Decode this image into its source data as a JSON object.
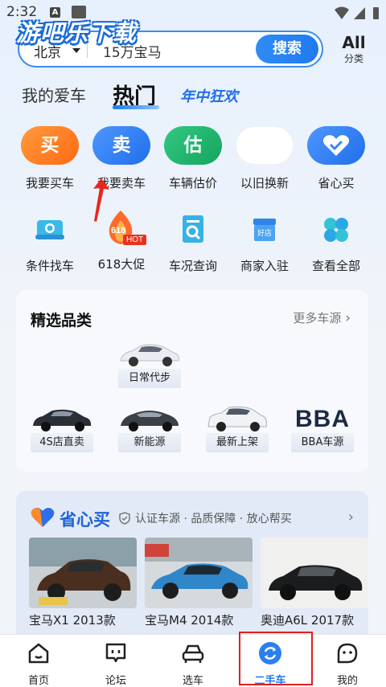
{
  "status_bar": {
    "time": "2:32",
    "notification_letter": "A"
  },
  "watermark": "游吧乐下载",
  "search": {
    "city": "北京",
    "query": "15万宝马",
    "button_label": "搜索"
  },
  "all_link": {
    "main": "All",
    "sub": "分类"
  },
  "tabs": {
    "my_car": "我的爱车",
    "hot": "热门",
    "promo": "年中狂欢"
  },
  "quick_actions": [
    {
      "label": "我要买车",
      "glyph": "买",
      "color": "#ff7a1a"
    },
    {
      "label": "我要卖车",
      "glyph": "卖",
      "color": "#2c7cf2"
    },
    {
      "label": "车辆估价",
      "glyph": "估",
      "color": "#19b46a"
    },
    {
      "label": "以旧换新",
      "glyph": "",
      "color": "#ffffff"
    },
    {
      "label": "省心买",
      "glyph": "heart-icon",
      "color": "#2c7cf2"
    }
  ],
  "tools": [
    {
      "label": "条件找车",
      "icon": "car-search-icon"
    },
    {
      "label": "618大促",
      "icon": "fire-618-icon",
      "badge_num": "618",
      "badge": "HOT"
    },
    {
      "label": "车况查询",
      "icon": "report-search-icon"
    },
    {
      "label": "商家入驻",
      "icon": "shop-icon",
      "shop_tag": "好店"
    },
    {
      "label": "查看全部",
      "icon": "grid-flower-icon"
    }
  ],
  "selection": {
    "title": "精选品类",
    "more": "更多车源",
    "featured": "日常代步",
    "categories": [
      "4S店直卖",
      "新能源",
      "最新上架",
      "BBA车源"
    ],
    "bba_text": "BBA"
  },
  "worry_free": {
    "title": "省心买",
    "subtitle": "认证车源 · 品质保障 · 放心帮买",
    "listings": [
      "宝马X1 2013款",
      "宝马M4 2014款",
      "奥迪A6L 2017款"
    ]
  },
  "bottom_nav": [
    {
      "label": "首页",
      "icon": "home-icon"
    },
    {
      "label": "论坛",
      "icon": "forum-icon"
    },
    {
      "label": "选车",
      "icon": "car-select-icon"
    },
    {
      "label": "二手车",
      "icon": "used-car-refresh-icon",
      "active": true
    },
    {
      "label": "我的",
      "icon": "profile-face-icon"
    }
  ],
  "colors": {
    "accent": "#1e78ee",
    "highlight": "#e02020"
  }
}
